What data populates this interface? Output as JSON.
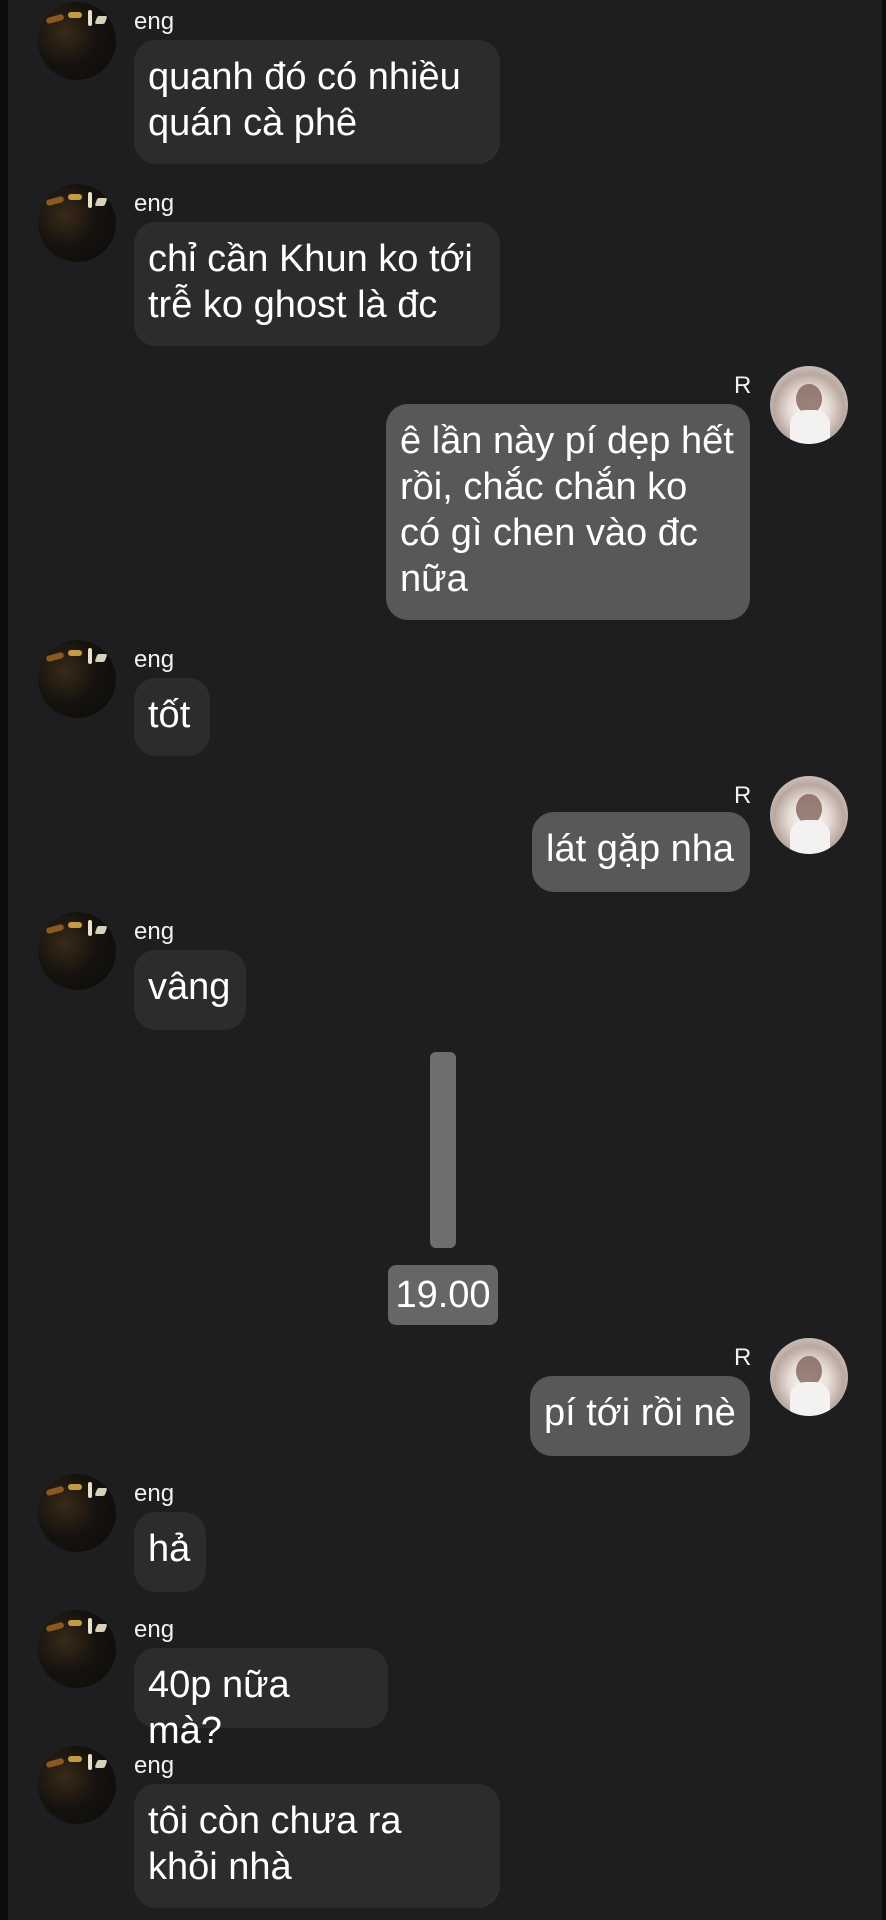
{
  "chat": {
    "contact_name": "eng",
    "self_name": "R",
    "messages": [
      {
        "sender": "eng",
        "text": "quanh đó có nhiều\nquán cà phê"
      },
      {
        "sender": "eng",
        "text": "chỉ cần Khun ko tới\ntrễ ko ghost là đc"
      },
      {
        "sender": "R",
        "text": "ê lần này pí dẹp hết\nrồi, chắc chắn ko\ncó gì chen vào đc\nnữa"
      },
      {
        "sender": "eng",
        "text": "tốt"
      },
      {
        "sender": "R",
        "text": "lát gặp nha"
      },
      {
        "sender": "eng",
        "text": "vâng"
      },
      {
        "sender": "R",
        "text": "pí tới rồi nè"
      },
      {
        "sender": "eng",
        "text": "hả"
      },
      {
        "sender": "eng",
        "text": "40p nữa mà?"
      },
      {
        "sender": "eng",
        "text": "tôi còn chưa ra\nkhỏi nhà"
      }
    ],
    "time_divider": "19.00"
  },
  "colors": {
    "background": "#1e1e20",
    "incoming_bubble": "#2c2c2f",
    "outgoing_bubble": "#58585a"
  }
}
